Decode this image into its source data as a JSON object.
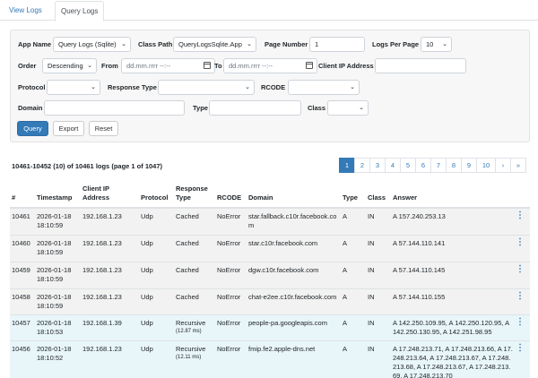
{
  "tabs": [
    {
      "label": "View Logs",
      "active": false
    },
    {
      "label": "Query Logs",
      "active": true
    }
  ],
  "filters": {
    "app_name": {
      "label": "App Name",
      "value": "Query Logs (Sqlite)"
    },
    "class_path": {
      "label": "Class Path",
      "value": "QueryLogsSqlite.App"
    },
    "page_number": {
      "label": "Page Number",
      "value": "1"
    },
    "logs_per_page": {
      "label": "Logs Per Page",
      "value": "10"
    },
    "order": {
      "label": "Order",
      "value": "Descending"
    },
    "from": {
      "label": "From",
      "placeholder": "dd.mm.rrrr --:--"
    },
    "to": {
      "label": "To",
      "placeholder": "dd.mm.rrrr --:--"
    },
    "client_ip": {
      "label": "Client IP Address",
      "value": ""
    },
    "protocol": {
      "label": "Protocol",
      "value": ""
    },
    "response_type": {
      "label": "Response Type",
      "value": ""
    },
    "rcode": {
      "label": "RCODE",
      "value": ""
    },
    "domain": {
      "label": "Domain",
      "value": ""
    },
    "type": {
      "label": "Type",
      "value": ""
    },
    "class": {
      "label": "Class",
      "value": ""
    }
  },
  "buttons": {
    "query": "Query",
    "export": "Export",
    "reset": "Reset"
  },
  "summary": "10461-10452 (10) of 10461 logs (page 1 of 1047)",
  "pagination": {
    "active": "1",
    "pages": [
      "1",
      "2",
      "3",
      "4",
      "5",
      "6",
      "7",
      "8",
      "9",
      "10",
      "›",
      "»"
    ]
  },
  "table": {
    "headers": {
      "num": "#",
      "timestamp": "Timestamp",
      "client_ip": "Client IP Address",
      "protocol": "Protocol",
      "response_type": "Response Type",
      "rcode": "RCODE",
      "domain": "Domain",
      "type": "Type",
      "class": "Class",
      "answer": "Answer"
    },
    "rows": [
      {
        "num": "10461",
        "date": "2026-01-18",
        "time": "18:10:59",
        "ip": "192.168.1.23",
        "protocol": "Udp",
        "response": "Cached",
        "response_time": "",
        "rcode": "NoError",
        "domain": "star.fallback.c10r.facebook.com",
        "type": "A",
        "class": "IN",
        "answer": "A 157.240.253.13"
      },
      {
        "num": "10460",
        "date": "2026-01-18",
        "time": "18:10:59",
        "ip": "192.168.1.23",
        "protocol": "Udp",
        "response": "Cached",
        "response_time": "",
        "rcode": "NoError",
        "domain": "star.c10r.facebook.com",
        "type": "A",
        "class": "IN",
        "answer": "A 57.144.110.141"
      },
      {
        "num": "10459",
        "date": "2026-01-18",
        "time": "18:10:59",
        "ip": "192.168.1.23",
        "protocol": "Udp",
        "response": "Cached",
        "response_time": "",
        "rcode": "NoError",
        "domain": "dgw.c10r.facebook.com",
        "type": "A",
        "class": "IN",
        "answer": "A 57.144.110.145"
      },
      {
        "num": "10458",
        "date": "2026-01-18",
        "time": "18:10:59",
        "ip": "192.168.1.23",
        "protocol": "Udp",
        "response": "Cached",
        "response_time": "",
        "rcode": "NoError",
        "domain": "chat-e2ee.c10r.facebook.com",
        "type": "A",
        "class": "IN",
        "answer": "A 57.144.110.155"
      },
      {
        "num": "10457",
        "date": "2026-01-18",
        "time": "18:10:53",
        "ip": "192.168.1.39",
        "protocol": "Udp",
        "response": "Recursive",
        "response_time": "(12.87 ms)",
        "rcode": "NoError",
        "domain": "people-pa.googleapis.com",
        "type": "A",
        "class": "IN",
        "answer": "A 142.250.109.95, A 142.250.120.95, A 142.250.130.95, A 142.251.98.95"
      },
      {
        "num": "10456",
        "date": "2026-01-18",
        "time": "18:10:52",
        "ip": "192.168.1.23",
        "protocol": "Udp",
        "response": "Recursive",
        "response_time": "(12.11 ms)",
        "rcode": "NoError",
        "domain": "fmip.fe2.apple-dns.net",
        "type": "A",
        "class": "IN",
        "answer": "A 17.248.213.71, A 17.248.213.66, A 17.248.213.64, A 17.248.213.67, A 17.248.213.68, A 17.248.213.67, A 17.248.213.69, A 17.248.213.70"
      }
    ]
  }
}
